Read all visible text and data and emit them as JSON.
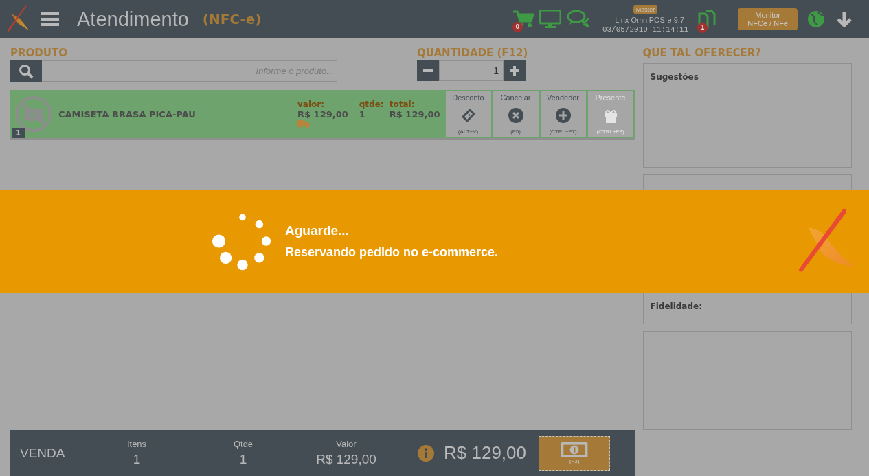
{
  "header": {
    "title": "Atendimento",
    "subtitle": "(NFC-e)",
    "cart_badge": "0",
    "env_badge": "Master",
    "app_version": "Linx OmniPOS-e  9.7",
    "datetime": "03/05/2019 11:14:11",
    "doc_badge": "1",
    "monitor_button": [
      "Monitor",
      "NFCe / NFe"
    ]
  },
  "product": {
    "label": "PRODUTO",
    "placeholder": "Informe o produto..."
  },
  "quantity": {
    "label": "QUANTIDADE (F12)",
    "value": "1"
  },
  "items": [
    {
      "index": "1",
      "name": "CAMISETA BRASA PICA-PAU",
      "value_label": "valor:",
      "value": "R$ 129,00",
      "qty_label": "qtde:",
      "qty": "1",
      "total_label": "total:",
      "total": "R$ 129,00",
      "delivery": true,
      "actions": [
        {
          "kind": "discount",
          "label": "Desconto",
          "shortcut": "(ALT+V)",
          "disabled": false
        },
        {
          "kind": "cancel",
          "label": "Cancelar",
          "shortcut": "(F5)",
          "disabled": false
        },
        {
          "kind": "seller",
          "label": "Vendedor",
          "shortcut": "(CTRL+F7)",
          "disabled": false
        },
        {
          "kind": "gift",
          "label": "Presente",
          "shortcut": "(CTRL+F8)",
          "disabled": true
        }
      ]
    }
  ],
  "suggestions": {
    "title": "QUE TAL OFERECER?",
    "panel_title": "Sugestões"
  },
  "customer": {
    "loyalty_label": "Fidelidade:"
  },
  "footer": {
    "label": "VENDA",
    "stats": [
      {
        "label": "Itens",
        "value": "1"
      },
      {
        "label": "Qtde",
        "value": "1"
      },
      {
        "label": "Valor",
        "value": "R$ 129,00"
      }
    ],
    "total": "R$ 129,00",
    "pay_shortcut": "(F3)"
  },
  "overlay": {
    "title": "Aguarde...",
    "message": "Reservando pedido no e-commerce."
  }
}
